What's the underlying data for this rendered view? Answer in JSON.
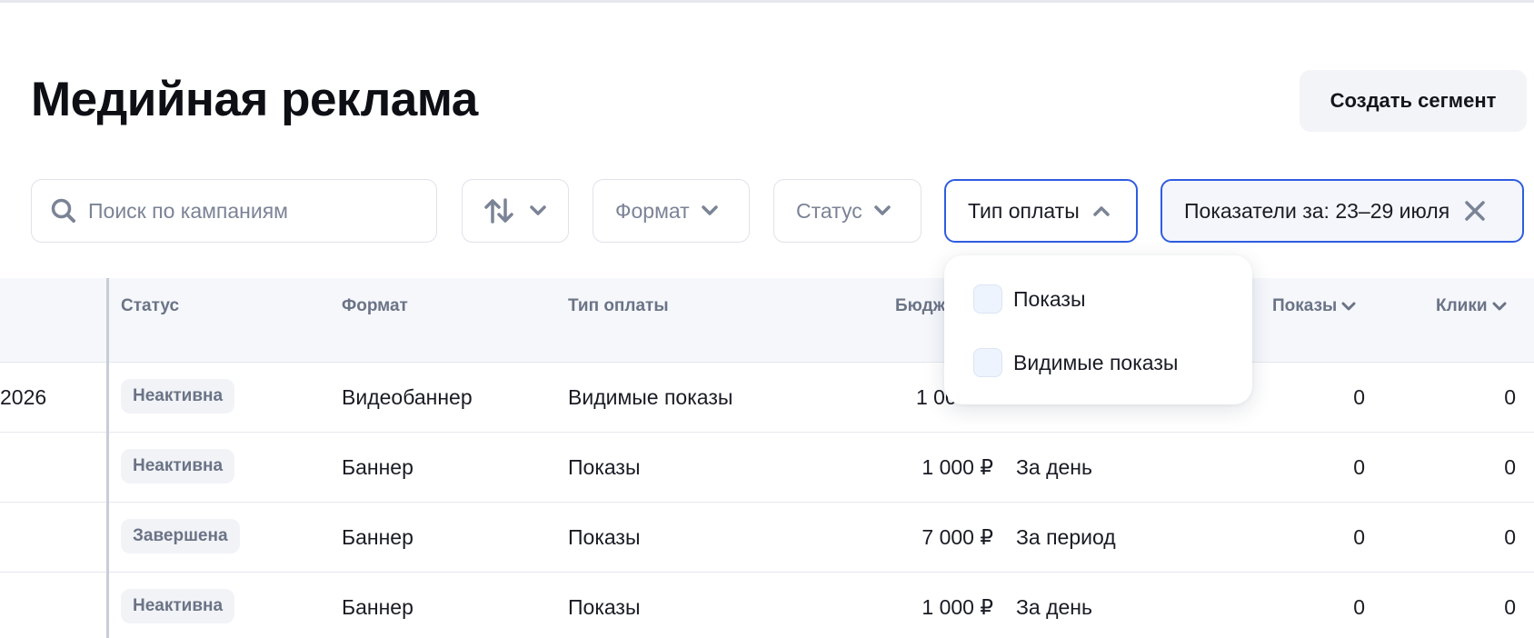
{
  "page": {
    "title": "Медийная реклама",
    "create_segment": "Создать сегмент"
  },
  "filters": {
    "search_placeholder": "Поиск по кампаниям",
    "format_label": "Формат",
    "status_label": "Статус",
    "payment_label": "Тип оплаты",
    "period_label": "Показатели за: 23–29 июля"
  },
  "icons": {
    "search": "search-icon",
    "sort": "sort-arrows-icon",
    "chevron_down": "chevron-down-icon",
    "chevron_up": "chevron-up-icon",
    "close": "close-icon"
  },
  "colors": {
    "accent": "#2f5ce0",
    "badge_bg": "#f1f3f7",
    "header_bg": "#f5f7fb"
  },
  "dropdown": {
    "options": [
      "Показы",
      "Видимые показы"
    ]
  },
  "table": {
    "headers": {
      "status": "Статус",
      "format": "Формат",
      "payment": "Тип оплаты",
      "budget": "Бюдж",
      "impressions": "Показы",
      "clicks": "Клики"
    },
    "rows": [
      {
        "lead": "2026",
        "status": "Неактивна",
        "format": "Видеобаннер",
        "payment": "Видимые показы",
        "budget": "1 00",
        "budget_type": "",
        "impressions": "0",
        "clicks": "0"
      },
      {
        "lead": "",
        "status": "Неактивна",
        "format": "Баннер",
        "payment": "Показы",
        "budget": "1 000 ₽",
        "budget_type": "За день",
        "impressions": "0",
        "clicks": "0"
      },
      {
        "lead": "",
        "status": "Завершена",
        "format": "Баннер",
        "payment": "Показы",
        "budget": "7 000 ₽",
        "budget_type": "За период",
        "impressions": "0",
        "clicks": "0"
      },
      {
        "lead": "",
        "status": "Неактивна",
        "format": "Баннер",
        "payment": "Показы",
        "budget": "1 000 ₽",
        "budget_type": "За день",
        "impressions": "0",
        "clicks": "0"
      }
    ]
  }
}
